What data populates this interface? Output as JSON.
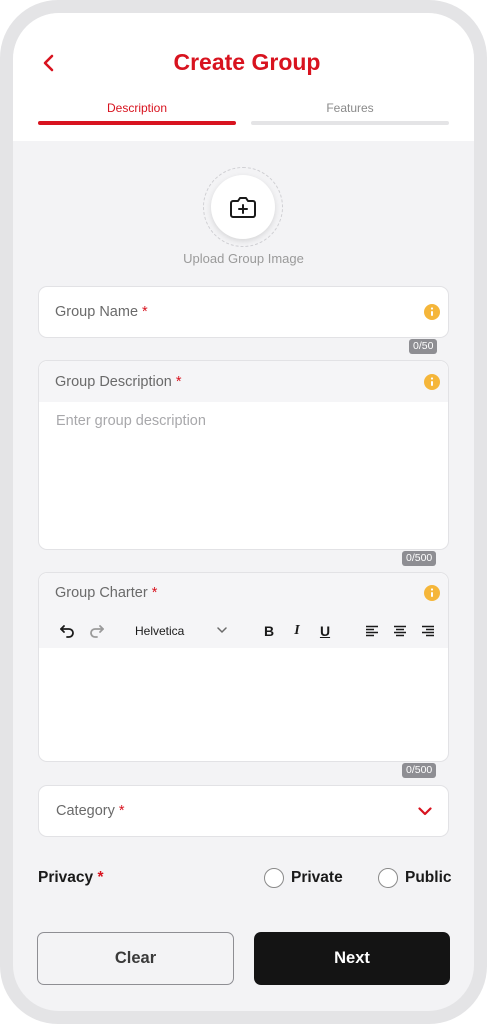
{
  "header": {
    "title": "Create Group",
    "tabs": [
      {
        "label": "Description",
        "active": true
      },
      {
        "label": "Features",
        "active": false
      }
    ]
  },
  "upload": {
    "label": "Upload Group Image",
    "icon": "camera-plus-icon"
  },
  "form": {
    "group_name": {
      "label": "Group Name",
      "required_mark": "*",
      "counter": "0/50",
      "value": ""
    },
    "group_description": {
      "label": "Group Description",
      "required_mark": "*",
      "placeholder": "Enter group description",
      "counter": "0/500"
    },
    "group_charter": {
      "label": "Group Charter",
      "required_mark": "*",
      "counter": "0/500",
      "toolbar": {
        "font": "Helvetica",
        "bold": "B",
        "italic": "I",
        "underline": "U"
      }
    },
    "category": {
      "label": "Category",
      "required_mark": "*"
    },
    "privacy": {
      "label": "Privacy",
      "required_mark": "*",
      "options": [
        {
          "label": "Private",
          "selected": false
        },
        {
          "label": "Public",
          "selected": false
        }
      ]
    }
  },
  "actions": {
    "clear_label": "Clear",
    "next_label": "Next"
  },
  "colors": {
    "accent": "#d8131f",
    "info": "#f5b63a",
    "primary_button": "#141414"
  }
}
